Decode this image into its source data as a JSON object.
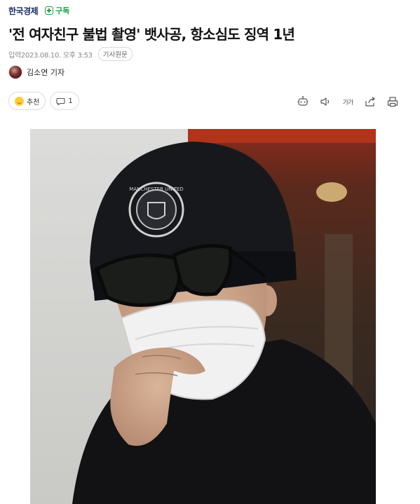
{
  "header": {
    "publisher": "한국경제",
    "subscribe_label": "구독"
  },
  "article": {
    "headline": "'전 여자친구 불법 촬영' 뱃사공, 항소심도 징역 1년",
    "date": "입력2023.08.10. 오후 3:53",
    "original_label": "기사원문",
    "reporter": "김소연 기자"
  },
  "actions": {
    "recommend_label": "추천",
    "comment_count": "1"
  },
  "tools": {
    "font_size_label": "가가",
    "icons": [
      "summary-robot-icon",
      "speaker-icon",
      "font-size-icon",
      "share-icon",
      "print-icon"
    ]
  },
  "photo": {
    "cap_logo_text": "MANCHESTER UNITED"
  },
  "colors": {
    "publisher": "#1b2e63",
    "subscribe": "#1aa04a",
    "cap": "#15161b"
  }
}
